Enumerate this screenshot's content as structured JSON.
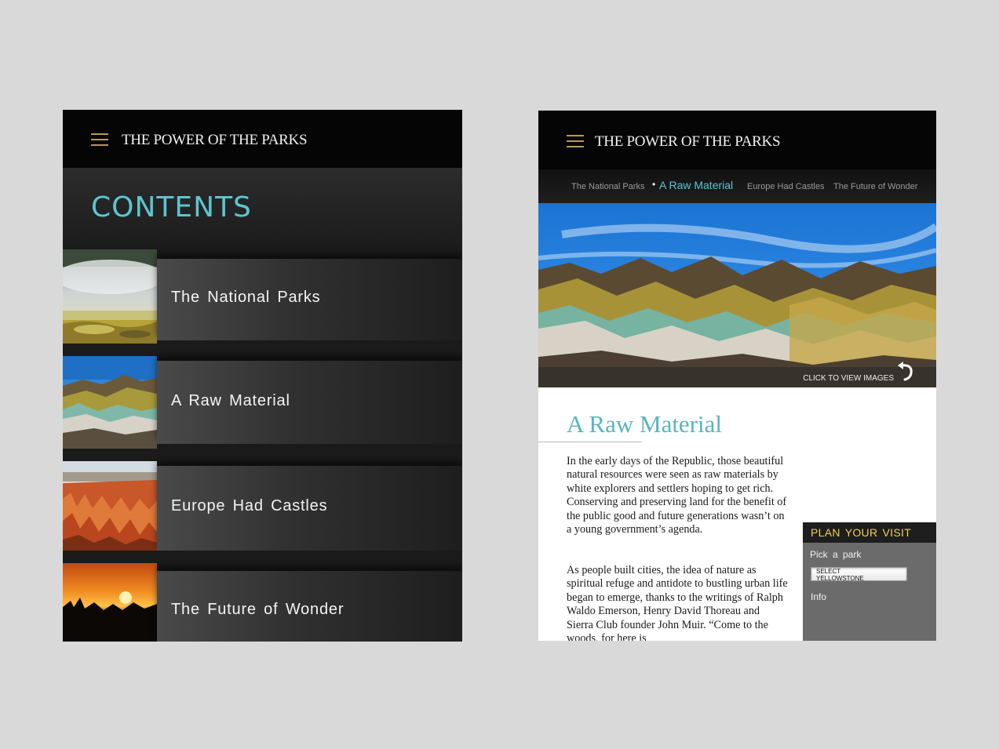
{
  "left_screen": {
    "header": {
      "title": "THE POWER OF THE PARKS"
    },
    "contents_title": "CONTENTS",
    "items": [
      {
        "label": "The National Parks"
      },
      {
        "label": "A Raw Material"
      },
      {
        "label": "Europe Had Castles"
      },
      {
        "label": "The Future of Wonder"
      }
    ]
  },
  "right_screen": {
    "header": {
      "title": "THE POWER OF THE PARKS"
    },
    "tabs": [
      {
        "label": "The National Parks",
        "active": false
      },
      {
        "label": "A Raw Material",
        "active": true
      },
      {
        "label": "Europe Had Castles",
        "active": false
      },
      {
        "label": "The Future of Wonder",
        "active": false
      }
    ],
    "hero": {
      "cta": "CLICK TO VIEW IMAGES"
    },
    "article": {
      "title": "A Raw Material",
      "paragraphs": [
        "In the early days of the Republic, those beautiful natural resources were seen as raw materials by white explorers and settlers hoping to get rich. Conserving and preserving land for the benefit of the public good and future generations wasn’t on a young government’s agenda.",
        "As people built cities, the idea of nature as spiritual refuge and antidote to bustling urban life began to emerge, thanks to the writings of Ralph Waldo Emerson, Henry David Thoreau and Sierra Club founder John Muir. “Come to the woods, for here is"
      ]
    },
    "plan_visit": {
      "title": "PLAN YOUR VISIT",
      "pick_label": "Pick a park",
      "select_value": "SELECT YELLOWSTONE",
      "info_label": "Info"
    }
  },
  "colors": {
    "background": "#d9d9d9",
    "accent_teal": "#5cc5d0",
    "accent_yellow": "#f0d34a",
    "menu_gold": "#b89a4e"
  },
  "icons": [
    "menu-icon",
    "back-arrow-icon"
  ]
}
